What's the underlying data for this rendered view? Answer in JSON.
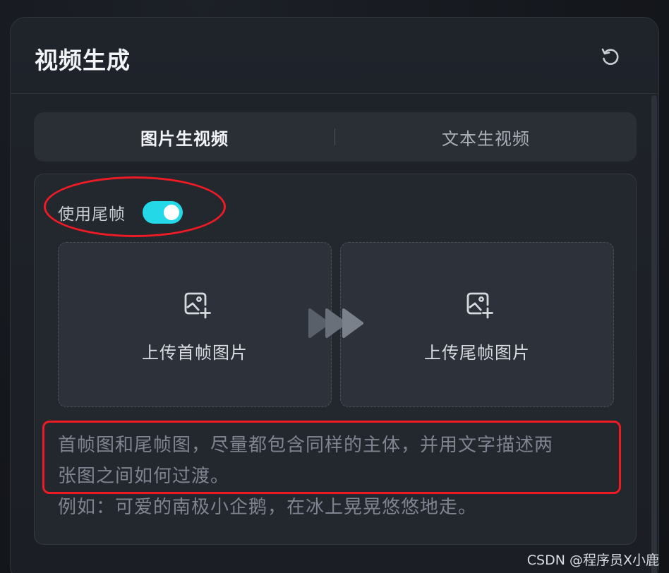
{
  "panel": {
    "title": "视频生成",
    "reset_icon": "refresh-icon"
  },
  "tabs": [
    {
      "label": "图片生视频",
      "active": true
    },
    {
      "label": "文本生视频",
      "active": false
    }
  ],
  "toggle": {
    "label": "使用尾帧",
    "on": true,
    "color": "#25d8e8"
  },
  "uploads": {
    "first": {
      "label": "上传首帧图片",
      "icon": "image-add-icon"
    },
    "last": {
      "label": "上传尾帧图片",
      "icon": "image-add-icon"
    },
    "arrow_icon": "fast-forward-icon"
  },
  "hint": {
    "line1": "首帧图和尾帧图，尽量都包含同样的主体，并用文字描述两",
    "line2": "张图之间如何过渡。",
    "example": "例如：可爱的南极小企鹅，在冰上晃晃悠悠地走。"
  },
  "annotation_color": "#ee1b24",
  "watermark": "CSDN @程序员X小鹿"
}
